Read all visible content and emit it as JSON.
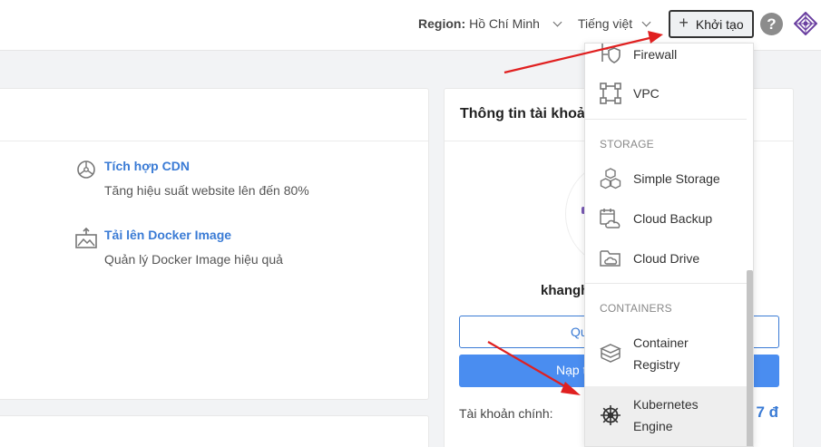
{
  "header": {
    "region_label": "Region:",
    "region_value": "Hồ Chí Minh",
    "language": "Tiếng việt",
    "create_button": "Khởi tạo",
    "help": "?"
  },
  "features": [
    {
      "title": "Tích hợp CDN",
      "desc": "Tăng hiệu suất website lên đến 80%",
      "icon": "cdn-icon"
    },
    {
      "title": "Tải lên Docker Image",
      "desc": "Quản lý Docker Image hiệu quả",
      "icon": "upload-image-icon"
    }
  ],
  "account_card": {
    "title": "Thông tin tài khoả",
    "username": "khangh",
    "outline_button": "Qu",
    "primary_button": "Nạp t",
    "main_account_label": "Tài khoản chính:",
    "main_account_value": "7 đ"
  },
  "dropdown": {
    "items_top": [
      {
        "label": "Firewall",
        "icon": "firewall-icon"
      },
      {
        "label": "VPC",
        "icon": "vpc-icon"
      }
    ],
    "storage_section": "STORAGE",
    "storage_items": [
      {
        "label": "Simple Storage",
        "icon": "cubes-icon"
      },
      {
        "label": "Cloud Backup",
        "icon": "cloud-backup-icon"
      },
      {
        "label": "Cloud Drive",
        "icon": "cloud-drive-icon"
      }
    ],
    "containers_section": "CONTAINERS",
    "container_items": [
      {
        "label_line1": "Container",
        "label_line2": "Registry",
        "icon": "layers-icon"
      },
      {
        "label_line1": "Kubernetes",
        "label_line2": "Engine",
        "icon": "helm-icon"
      }
    ]
  },
  "colors": {
    "accent": "#3a7bd5",
    "primary_button": "#4a8df0",
    "annotation_arrow": "#e02020"
  }
}
